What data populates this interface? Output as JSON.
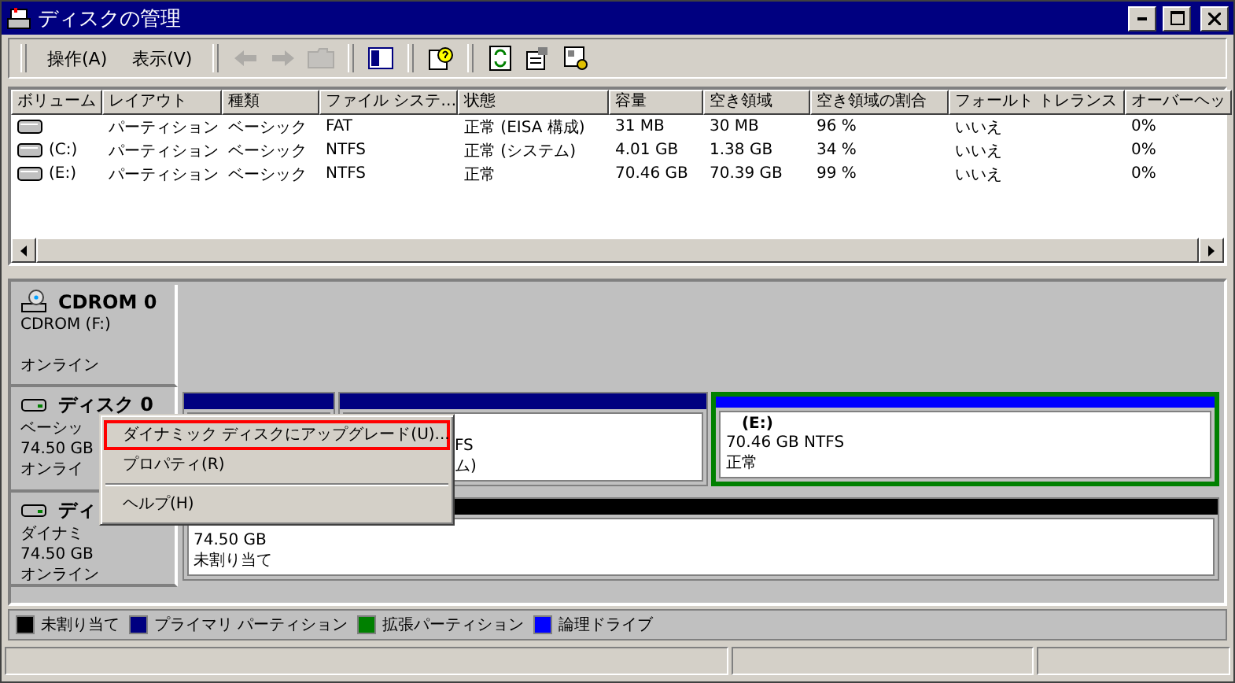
{
  "window": {
    "title": "ディスクの管理"
  },
  "menu": [
    {
      "label": "操作(A)"
    },
    {
      "label": "表示(V)"
    }
  ],
  "toolbar": [
    {
      "disabled": true
    },
    {
      "disabled": true
    },
    {
      "disabled": true
    },
    {
      "disabled": false
    },
    {
      "disabled": false
    },
    {
      "disabled": false
    },
    {
      "disabled": false
    },
    {
      "disabled": false
    }
  ],
  "volumes": {
    "columns": [
      "ボリューム",
      "レイアウト",
      "種類",
      "ファイル システ…",
      "状態",
      "容量",
      "空き領域",
      "空き領域の割合",
      "フォールト トレランス",
      "オーバーヘッ"
    ],
    "rows": [
      [
        "",
        "パーティション",
        "ベーシック",
        "FAT",
        "正常 (EISA 構成)",
        "31 MB",
        "30 MB",
        "96 %",
        "いいえ",
        "0%"
      ],
      [
        "(C:)",
        "パーティション",
        "ベーシック",
        "NTFS",
        "正常 (システム)",
        "4.01 GB",
        "1.38 GB",
        "34 %",
        "いいえ",
        "0%"
      ],
      [
        "(E:)",
        "パーティション",
        "ベーシック",
        "NTFS",
        "正常",
        "70.46 GB",
        "70.39 GB",
        "99 %",
        "いいえ",
        "0%"
      ]
    ]
  },
  "disks": [
    {
      "kind": "cdrom",
      "name": "CDROM 0",
      "lines": [
        "CDROM (F:)",
        "オンライン"
      ]
    },
    {
      "kind": "disk",
      "name": "ディスク 0",
      "lines": [
        "ベーシッ",
        "74.50 GB",
        "オンライ"
      ],
      "partitions": [
        {
          "color": "#000080",
          "extended": false
        },
        {
          "color": "#000080",
          "extended": false,
          "lines": [
            "FS",
            "ム)"
          ]
        },
        {
          "color": "#0000ff",
          "extended": true,
          "title": "(E:)",
          "lines": [
            "70.46 GB NTFS",
            "正常"
          ]
        }
      ]
    },
    {
      "kind": "disk",
      "name": "ディ",
      "lines": [
        "ダイナミ",
        "74.50 GB",
        "オンライン"
      ],
      "partitions": [
        {
          "color": "#000000",
          "extended": false,
          "lines": [
            "74.50 GB",
            "未割り当て"
          ]
        }
      ]
    }
  ],
  "context_menu": {
    "items": [
      {
        "label": "ダイナミック ディスクにアップグレード(U)...",
        "annotated": true
      },
      {
        "label": "プロパティ(R)",
        "annotated": false
      },
      {
        "label": "ヘルプ(H)",
        "annotated": false,
        "separator_before": true
      }
    ]
  },
  "legend": [
    {
      "label": "未割り当て",
      "color": "#000000"
    },
    {
      "label": "プライマリ パーティション",
      "color": "#000080"
    },
    {
      "label": "拡張パーティション",
      "color": "#008000"
    },
    {
      "label": "論理ドライブ",
      "color": "#0000ff"
    }
  ]
}
